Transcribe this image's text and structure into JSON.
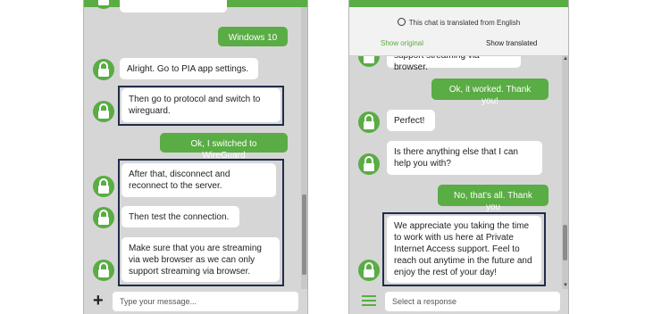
{
  "left": {
    "messages": {
      "u1": "Windows 10",
      "a1": "Alright. Go to PIA app settings.",
      "a2": "Then go to protocol and switch to wireguard.",
      "u2": "Ok, I switched to WireGuard",
      "a3": "After that, disconnect and reconnect to the server.",
      "a4": "Then test the connection.",
      "a5": "Make sure that you are streaming via web browser as we can only support streaming via browser."
    },
    "input_placeholder": "Type your message...",
    "add_symbol": "+"
  },
  "right": {
    "translate_notice": "This chat is translated from English",
    "tab_original": "Show original",
    "tab_translated": "Show translated",
    "messages": {
      "a0": "support streaming via browser.",
      "u1": "Ok, it worked. Thank you!",
      "a1": "Perfect!",
      "a2": "Is there anything else that I can help you with?",
      "u2": "No, that's all. Thank you",
      "a3": "We appreciate you taking the time to work with us here at Private Internet Access support. Feel to reach out anytime in the future and enjoy the rest of your day!"
    },
    "input_placeholder": "Select a response"
  },
  "colors": {
    "accent": "#5aac44",
    "highlight_border": "#1f2d4a",
    "panel_bg": "#d6d6d6"
  },
  "icons": {
    "agent_avatar": "lock-icon",
    "menu": "hamburger-icon",
    "add": "plus-icon",
    "translate": "globe-icon"
  }
}
